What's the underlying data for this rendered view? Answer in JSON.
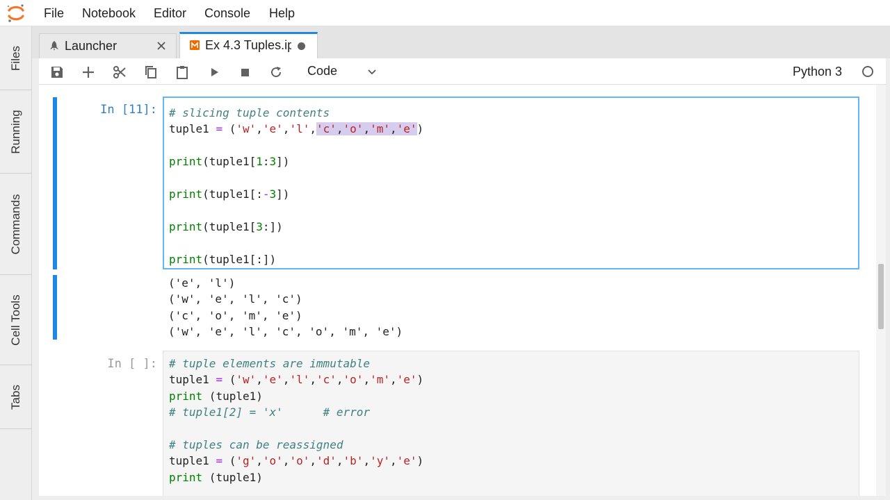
{
  "menubar": {
    "items": [
      "File",
      "Notebook",
      "Editor",
      "Console",
      "Help"
    ]
  },
  "left_sidebar": {
    "tabs": [
      "Files",
      "Running",
      "Commands",
      "Cell Tools",
      "Tabs"
    ]
  },
  "tabs": [
    {
      "label": "Launcher",
      "icon": "rocket-icon",
      "active": false
    },
    {
      "label": "Ex 4.3 Tuples.ip",
      "icon": "notebook-icon",
      "active": true,
      "modified": true
    }
  ],
  "toolbar": {
    "cell_type": "Code",
    "kernel_name": "Python 3",
    "buttons": [
      "save-icon",
      "add-icon",
      "cut-icon",
      "copy-icon",
      "paste-icon",
      "run-icon",
      "stop-icon",
      "restart-icon"
    ]
  },
  "cells": [
    {
      "prompt": "In [11]:",
      "active": true,
      "lines": [
        [
          {
            "t": "# slicing tuple contents",
            "c": "com"
          }
        ],
        [
          {
            "t": "tuple1 ",
            "c": ""
          },
          {
            "t": "=",
            "c": "op"
          },
          {
            "t": " (",
            "c": ""
          },
          {
            "t": "'w'",
            "c": "str"
          },
          {
            "t": ",",
            "c": ""
          },
          {
            "t": "'e'",
            "c": "str"
          },
          {
            "t": ",",
            "c": ""
          },
          {
            "t": "'l'",
            "c": "str"
          },
          {
            "t": ",",
            "c": ""
          },
          {
            "t": "'c'",
            "c": "str sel"
          },
          {
            "t": ",",
            "c": "sel"
          },
          {
            "t": "'o'",
            "c": "str sel"
          },
          {
            "t": ",",
            "c": "sel"
          },
          {
            "t": "'m'",
            "c": "str sel"
          },
          {
            "t": ",",
            "c": "sel"
          },
          {
            "t": "'e'",
            "c": "str sel"
          },
          {
            "t": ")",
            "c": ""
          }
        ],
        [],
        [
          {
            "t": "print",
            "c": "kw"
          },
          {
            "t": "(tuple1[",
            "c": ""
          },
          {
            "t": "1",
            "c": "num"
          },
          {
            "t": ":",
            "c": ""
          },
          {
            "t": "3",
            "c": "num"
          },
          {
            "t": "])",
            "c": ""
          }
        ],
        [],
        [
          {
            "t": "print",
            "c": "kw"
          },
          {
            "t": "(tuple1[:",
            "c": ""
          },
          {
            "t": "-",
            "c": "op"
          },
          {
            "t": "3",
            "c": "num"
          },
          {
            "t": "])",
            "c": ""
          }
        ],
        [],
        [
          {
            "t": "print",
            "c": "kw"
          },
          {
            "t": "(tuple1[",
            "c": ""
          },
          {
            "t": "3",
            "c": "num"
          },
          {
            "t": ":])",
            "c": ""
          }
        ],
        [],
        [
          {
            "t": "print",
            "c": "kw"
          },
          {
            "t": "(tuple1[:])",
            "c": ""
          }
        ]
      ],
      "output": [
        "('e', 'l')",
        "('w', 'e', 'l', 'c')",
        "('c', 'o', 'm', 'e')",
        "('w', 'e', 'l', 'c', 'o', 'm', 'e')"
      ]
    },
    {
      "prompt": "In [ ]:",
      "active": false,
      "lines": [
        [
          {
            "t": "# tuple elements are immutable",
            "c": "com"
          }
        ],
        [
          {
            "t": "tuple1 ",
            "c": ""
          },
          {
            "t": "=",
            "c": "op"
          },
          {
            "t": " (",
            "c": ""
          },
          {
            "t": "'w'",
            "c": "str"
          },
          {
            "t": ",",
            "c": ""
          },
          {
            "t": "'e'",
            "c": "str"
          },
          {
            "t": ",",
            "c": ""
          },
          {
            "t": "'l'",
            "c": "str"
          },
          {
            "t": ",",
            "c": ""
          },
          {
            "t": "'c'",
            "c": "str"
          },
          {
            "t": ",",
            "c": ""
          },
          {
            "t": "'o'",
            "c": "str"
          },
          {
            "t": ",",
            "c": ""
          },
          {
            "t": "'m'",
            "c": "str"
          },
          {
            "t": ",",
            "c": ""
          },
          {
            "t": "'e'",
            "c": "str"
          },
          {
            "t": ")",
            "c": ""
          }
        ],
        [
          {
            "t": "print",
            "c": "kw"
          },
          {
            "t": " (tuple1)",
            "c": ""
          }
        ],
        [
          {
            "t": "# tuple1[2] = 'x'      # error",
            "c": "com"
          }
        ],
        [],
        [
          {
            "t": "# tuples can be reassigned",
            "c": "com"
          }
        ],
        [
          {
            "t": "tuple1 ",
            "c": ""
          },
          {
            "t": "=",
            "c": "op"
          },
          {
            "t": " (",
            "c": ""
          },
          {
            "t": "'g'",
            "c": "str"
          },
          {
            "t": ",",
            "c": ""
          },
          {
            "t": "'o'",
            "c": "str"
          },
          {
            "t": ",",
            "c": ""
          },
          {
            "t": "'o'",
            "c": "str"
          },
          {
            "t": ",",
            "c": ""
          },
          {
            "t": "'d'",
            "c": "str"
          },
          {
            "t": ",",
            "c": ""
          },
          {
            "t": "'b'",
            "c": "str"
          },
          {
            "t": ",",
            "c": ""
          },
          {
            "t": "'y'",
            "c": "str"
          },
          {
            "t": ",",
            "c": ""
          },
          {
            "t": "'e'",
            "c": "str"
          },
          {
            "t": ")",
            "c": ""
          }
        ],
        [
          {
            "t": "print",
            "c": "kw"
          },
          {
            "t": " (tuple1)",
            "c": ""
          }
        ]
      ],
      "output": []
    }
  ],
  "colors": {
    "accent": "#1e88e5",
    "active_border": "#64b5f6",
    "prompt_active": "#307fc1",
    "string": "#ba2121",
    "keyword": "#008000",
    "comment": "#408080",
    "selection": "#d6cdee"
  }
}
